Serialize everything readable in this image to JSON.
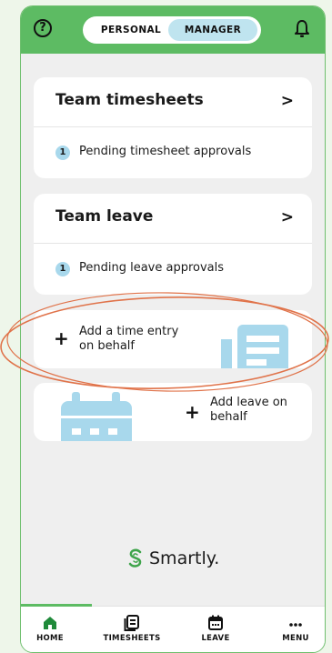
{
  "header": {
    "help_icon": "?",
    "segment": {
      "personal_label": "PERSONAL",
      "manager_label": "MANAGER",
      "selected": "MANAGER"
    }
  },
  "cards": [
    {
      "title": "Team timesheets",
      "badge": "1",
      "row_text": "Pending timesheet approvals"
    },
    {
      "title": "Team leave",
      "badge": "1",
      "row_text": "Pending leave approvals"
    }
  ],
  "actions": {
    "time_entry": {
      "label_line1": "Add a time entry",
      "label_line2": "on behalf"
    },
    "leave": {
      "label_line1": "Add leave on",
      "label_line2": "behalf"
    }
  },
  "brand": {
    "name": "Smartly."
  },
  "tabs": [
    {
      "label": "HOME",
      "icon": "home-icon"
    },
    {
      "label": "TIMESHEETS",
      "icon": "timesheets-icon"
    },
    {
      "label": "LEAVE",
      "icon": "calendar-icon"
    },
    {
      "label": "MENU",
      "icon": "more-icon"
    }
  ],
  "colors": {
    "accent_green": "#5dbb63",
    "selected_segment": "#bfe4ef",
    "illustration_blue": "#a8d8ec",
    "annotation_circle": "#e0734a"
  }
}
